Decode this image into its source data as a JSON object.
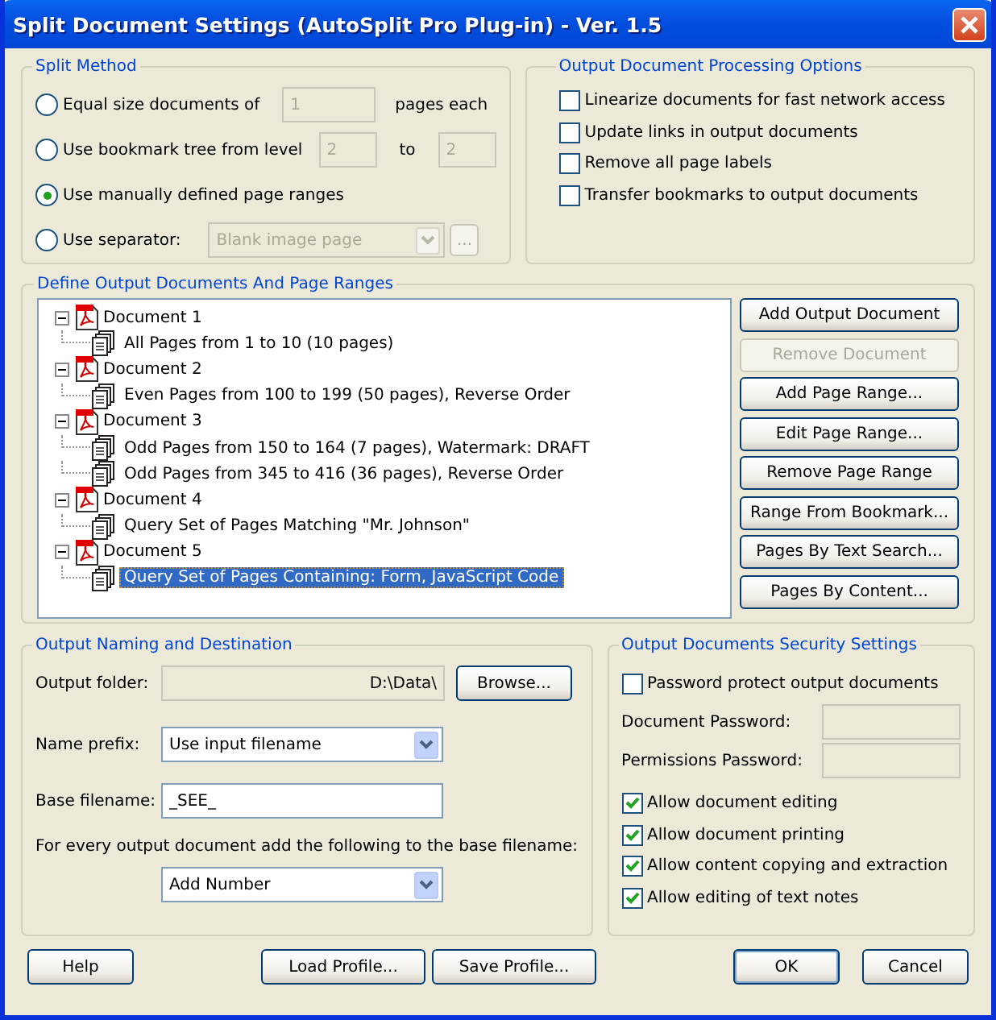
{
  "window": {
    "title": "Split Document Settings (AutoSplit Pro Plug-in) - Ver. 1.5"
  },
  "split_method": {
    "title": "Split Method",
    "options": [
      {
        "kind": "equal",
        "label": "Equal size documents of",
        "selected": false,
        "value": "1",
        "suffix": "pages each"
      },
      {
        "kind": "bookmark",
        "label": "Use bookmark tree from level",
        "selected": false,
        "value": "2",
        "between": "to",
        "value2": "2"
      },
      {
        "kind": "plain",
        "label": "Use manually defined page ranges",
        "selected": true
      },
      {
        "kind": "separator",
        "label": "Use separator:",
        "selected": false,
        "value": "Blank image page",
        "button": "..."
      }
    ]
  },
  "processing": {
    "title": "Output Document Processing Options",
    "options": [
      {
        "label": "Linearize documents for fast network access",
        "checked": false
      },
      {
        "label": "Update links in output documents",
        "checked": false
      },
      {
        "label": "Remove all page labels",
        "checked": false
      },
      {
        "label": "Transfer bookmarks to output documents",
        "checked": false
      }
    ]
  },
  "ranges": {
    "title": "Define Output Documents And Page Ranges",
    "documents": [
      {
        "label": "Document 1",
        "expanded": true,
        "children": [
          {
            "label": "All Pages from 1 to 10 (10 pages)",
            "selected": false
          }
        ]
      },
      {
        "label": "Document 2",
        "expanded": true,
        "children": [
          {
            "label": "Even Pages from 100 to 199 (50 pages), Reverse Order",
            "selected": false
          }
        ]
      },
      {
        "label": "Document 3",
        "expanded": true,
        "children": [
          {
            "label": "Odd Pages from 150 to 164 (7 pages), Watermark: DRAFT",
            "selected": false
          },
          {
            "label": "Odd Pages from 345 to 416 (36 pages), Reverse Order",
            "selected": false
          }
        ]
      },
      {
        "label": "Document 4",
        "expanded": true,
        "children": [
          {
            "label": "Query Set of Pages Matching \"Mr. Johnson\"",
            "selected": false
          }
        ]
      },
      {
        "label": "Document 5",
        "expanded": true,
        "children": [
          {
            "label": "Query Set of Pages Containing: Form, JavaScript Code",
            "selected": true
          }
        ]
      }
    ],
    "buttons": [
      {
        "label": "Add Output Document",
        "disabled": false
      },
      {
        "label": "Remove Document",
        "disabled": true
      },
      {
        "label": "Add Page Range...",
        "disabled": false
      },
      {
        "label": "Edit Page Range...",
        "disabled": false
      },
      {
        "label": "Remove Page Range",
        "disabled": false
      },
      {
        "label": "Range From Bookmark...",
        "disabled": false
      },
      {
        "label": "Pages By Text Search...",
        "disabled": false
      },
      {
        "label": "Pages By Content...",
        "disabled": false
      }
    ]
  },
  "naming": {
    "title": "Output Naming and Destination",
    "output_folder": {
      "label": "Output folder:",
      "value": "D:\\Data\\"
    },
    "browse": "Browse...",
    "name_prefix": {
      "label": "Name prefix:",
      "value": "Use input filename"
    },
    "base_filename": {
      "label": "Base filename:",
      "value": "_SEE_"
    },
    "suffix_note": "For every output document add the following to the base filename:",
    "suffix": {
      "value": "Add Number"
    }
  },
  "security": {
    "title": "Output Documents Security Settings",
    "protect": {
      "label": "Password protect output documents",
      "checked": false
    },
    "fields": [
      {
        "label": "Document Password:"
      },
      {
        "label": "Permissions Password:"
      }
    ],
    "permissions": [
      {
        "label": "Allow document editing",
        "checked": true
      },
      {
        "label": "Allow document printing",
        "checked": true
      },
      {
        "label": "Allow content copying and extraction",
        "checked": true
      },
      {
        "label": "Allow editing of text notes",
        "checked": true
      }
    ]
  },
  "footer": {
    "left": [
      {
        "label": "Help",
        "default": false
      }
    ],
    "middle": [
      {
        "label": "Load Profile...",
        "default": false
      },
      {
        "label": "Save Profile...",
        "default": false
      }
    ],
    "right": [
      {
        "label": "OK",
        "default": true
      },
      {
        "label": "Cancel",
        "default": false
      }
    ]
  }
}
